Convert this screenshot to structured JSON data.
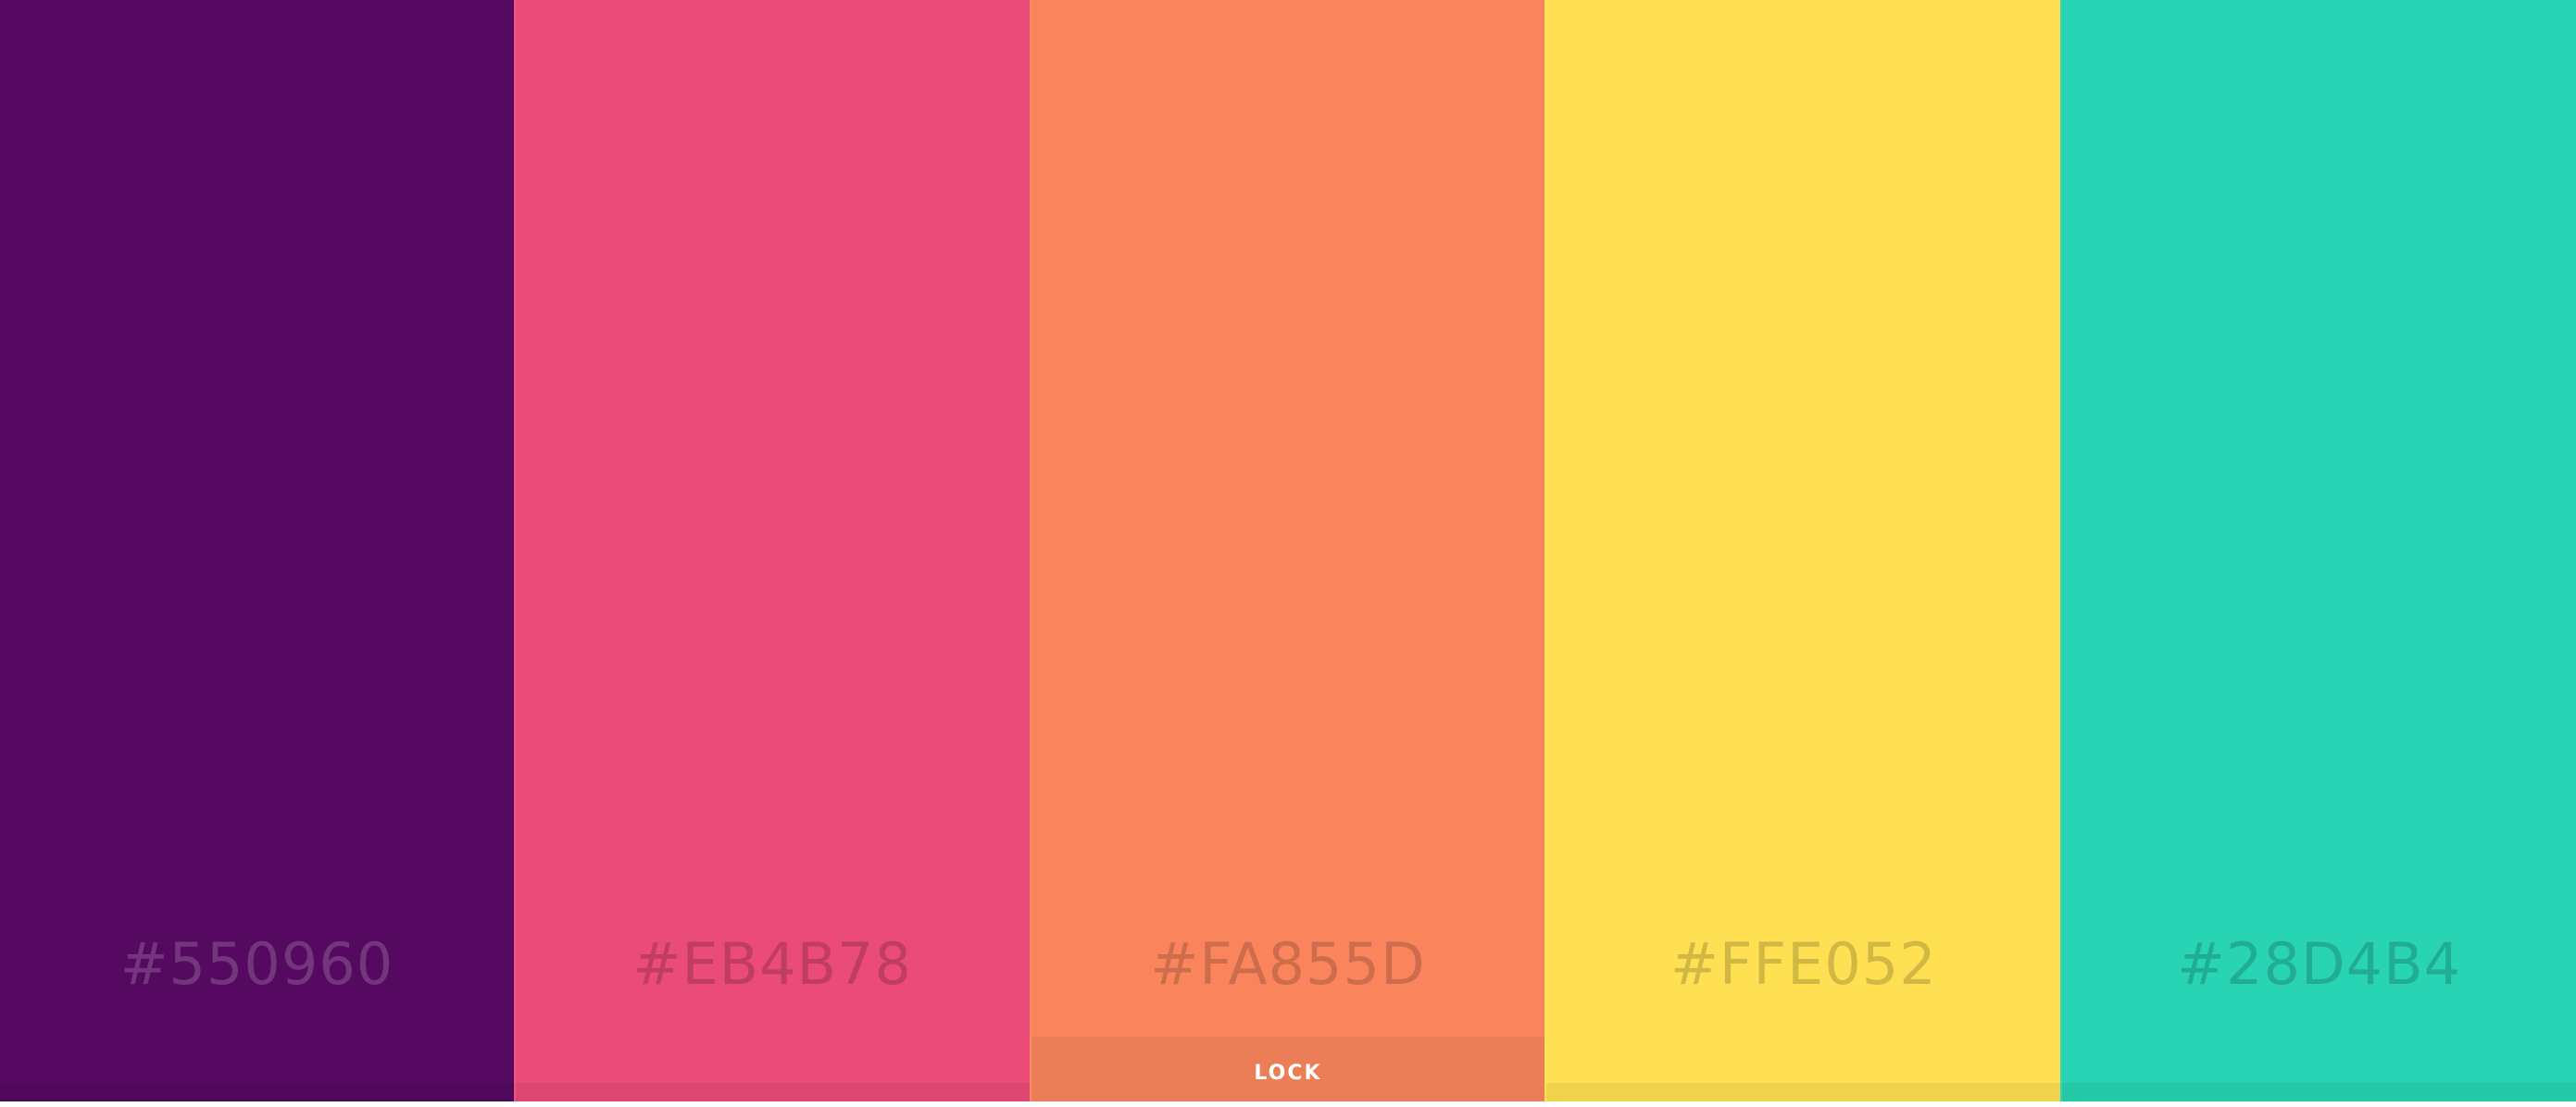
{
  "palette": {
    "swatches": [
      {
        "hex": "#550960",
        "color": "#550960"
      },
      {
        "hex": "#EB4B78",
        "color": "#EB4B78"
      },
      {
        "hex": "#FA855D",
        "color": "#FA855D",
        "action_label": "LOCK"
      },
      {
        "hex": "#FFE052",
        "color": "#FFE052"
      },
      {
        "hex": "#28D4B4",
        "color": "#28D4B4"
      }
    ]
  }
}
